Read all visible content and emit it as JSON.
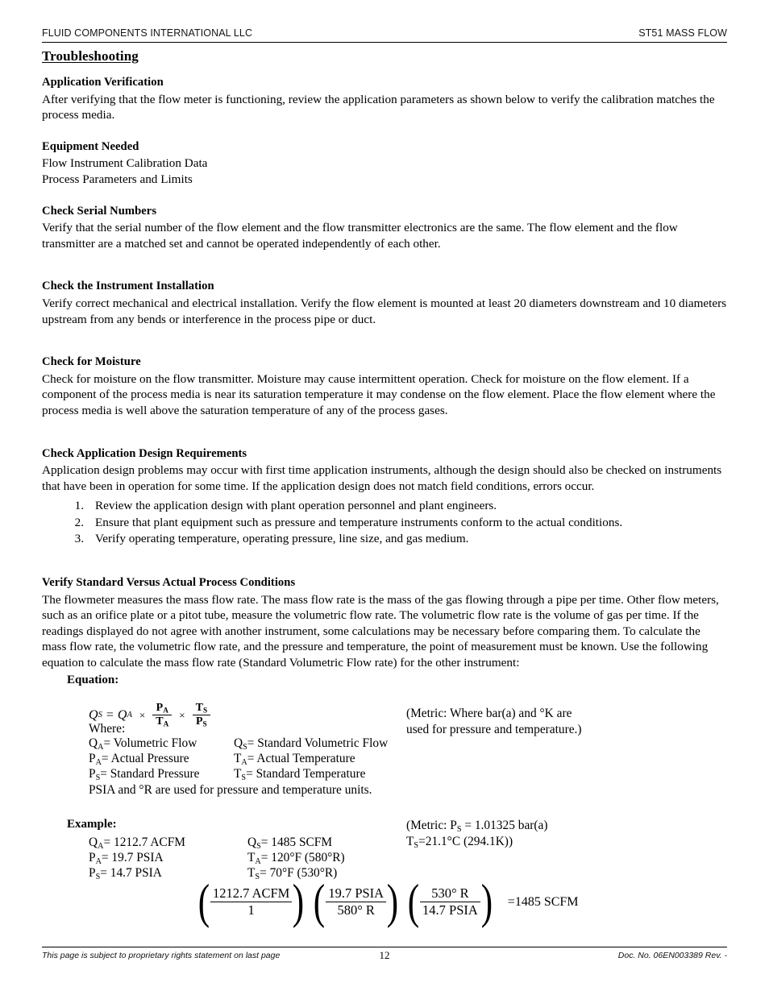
{
  "header": {
    "left": "FLUID COMPONENTS INTERNATIONAL LLC",
    "right": "ST51 MASS FLOW"
  },
  "chapter_title": "Troubleshooting",
  "sections": [
    {
      "heading": "Application Verification",
      "body": "After verifying that the flow meter is functioning, review the application parameters as shown below to verify the calibration matches the process media."
    },
    {
      "heading": "Equipment Needed",
      "lines": [
        "Flow Instrument Calibration Data",
        "Process Parameters and Limits"
      ]
    },
    {
      "heading": "Check Serial Numbers",
      "body": "Verify that the serial number of the flow element and the flow transmitter electronics are the same. The flow element and the flow transmitter are a matched set and cannot be operated independently of each other."
    },
    {
      "heading": "Check the Instrument Installation",
      "body": "Verify correct mechanical and electrical installation. Verify the flow element is mounted at least 20 diameters downstream and 10 diameters upstream from any bends or interference in the process pipe or duct."
    },
    {
      "heading": "Check for Moisture",
      "body": "Check for moisture on the flow transmitter.  Moisture may cause intermittent operation. Check for moisture on the flow element.  If a component of the process media is near its saturation temperature it may condense on the flow element.  Place the flow element where the process media is well above the saturation temperature of any of the process gases."
    },
    {
      "heading": "Check Application Design Requirements",
      "body": "Application design problems may occur with first time application instruments, although the design should also be checked on instruments that have been in operation for some time.  If the application design does not match field conditions, errors occur.",
      "list": [
        "Review the application design with plant operation personnel and plant engineers.",
        "Ensure that plant equipment such as pressure and temperature instruments conform to the actual conditions.",
        "Verify operating temperature, operating pressure, line size, and gas medium."
      ]
    },
    {
      "heading": "Verify Standard Versus Actual Process Conditions",
      "body": "The flowmeter measures the mass flow rate.  The mass flow rate is the mass of the gas flowing through a pipe per time.  Other flow meters, such as an orifice plate or a pitot tube, measure the volumetric flow rate.  The volumetric flow rate is the volume of gas per time.  If the readings displayed do not agree with another instrument, some calculations may be necessary before comparing them.  To calculate the mass flow rate, the volumetric flow rate, and the pressure and temperature, the point of measurement must be known.  Use the following equation to calculate the mass flow rate (Standard Volumetric Flow rate) for the other instrument:"
    }
  ],
  "equation_block": {
    "label": "Equation:",
    "formula": {
      "lhs_symbol": "Q",
      "lhs_sub": "S",
      "equals": "=",
      "rhs_symbol": "Q",
      "rhs_sub": "A",
      "operator": "×",
      "frac1_num": "P",
      "frac1_num_sub": "A",
      "frac1_den": "T",
      "frac1_den_sub": "A",
      "frac2_num": "T",
      "frac2_num_sub": "S",
      "frac2_den": "P",
      "frac2_den_sub": "S"
    },
    "where_label": "Where:",
    "definitions": [
      {
        "left_sym": "Q",
        "left_sub": "A",
        "left_text": "=  Volumetric Flow",
        "right_sym": "Q",
        "right_sub": "S",
        "right_text": "=  Standard Volumetric Flow"
      },
      {
        "left_sym": "P",
        "left_sub": "A",
        "left_text": "=    Actual Pressure",
        "right_sym": "T",
        "right_sub": "A",
        "right_text": "=  Actual Temperature"
      },
      {
        "left_sym": "P",
        "left_sub": "S",
        "left_text": "=  Standard Pressure",
        "right_sym": "T",
        "right_sub": "S",
        "right_text": "=  Standard Temperature"
      }
    ],
    "units_note": "PSIA and °R are used for pressure and temperature units.",
    "metric_note_line1": "(Metric: Where bar(a) and °K are",
    "metric_note_line2": "used for pressure and temperature.)"
  },
  "example_block": {
    "label": "Example:",
    "values": [
      {
        "left_sym": "Q",
        "left_sub": "A",
        "left_text": "=  1212.7 ACFM",
        "right_sym": "Q",
        "right_sub": "S",
        "right_text": "=  1485 SCFM"
      },
      {
        "left_sym": "P",
        "left_sub": "A",
        "left_text": "=  19.7 PSIA",
        "right_sym": "T",
        "right_sub": "A",
        "right_text": "=  120°F (580°R)"
      },
      {
        "left_sym": "P",
        "left_sub": "S",
        "left_text": "=  14.7 PSIA",
        "right_sym": "T",
        "right_sub": "S",
        "right_text": "=  70°F (530°R)"
      }
    ],
    "metric_note_line1_pre": "(Metric:  P",
    "metric_note_line1_sub": "S",
    "metric_note_line1_post": " = 1.01325 bar(a)",
    "metric_note_line2_pre": "T",
    "metric_note_line2_sub": "S",
    "metric_note_line2_post": "=21.1°C (294.1K))"
  },
  "final_equation": {
    "f1_num": "1212.7 ACFM",
    "f1_den": "1",
    "f2_num": "19.7 PSIA",
    "f2_den": "580° R",
    "f3_num": "530° R",
    "f3_den": "14.7 PSIA",
    "result": "=1485 SCFM",
    "open_paren": "(",
    "close_paren": ")"
  },
  "footer": {
    "left": "This page is subject to proprietary rights statement on last page",
    "center": "12",
    "right": "Doc. No. 06EN003389 Rev. -"
  }
}
